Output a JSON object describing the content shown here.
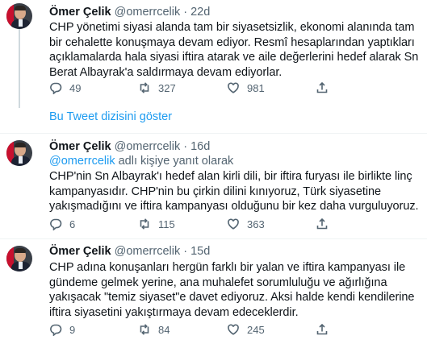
{
  "tweets": [
    {
      "name": "Ömer Çelik",
      "handle": "@omerrcelik",
      "dot": "·",
      "time": "22d",
      "reply_prefix": "",
      "reply_mention": "",
      "reply_suffix": "",
      "text": "CHP yönetimi siyasi alanda tam bir siyasetsizlik, ekonomi alanında tam bir cehalette konuşmaya devam ediyor. Resmî hesaplarından yaptıkları açıklamalarda hala siyasi iftira atarak ve aile değerlerini hedef alarak Sn Berat Albayrak'a saldırmaya devam ediyorlar.",
      "replies": "49",
      "retweets": "327",
      "likes": "981"
    },
    {
      "name": "Ömer Çelik",
      "handle": "@omerrcelik",
      "dot": "·",
      "time": "16d",
      "reply_prefix": "",
      "reply_mention": "@omerrcelik",
      "reply_suffix": " adlı kişiye yanıt olarak",
      "text": "CHP'nin Sn Albayrak'ı hedef alan kirli dili, bir iftira furyası ile birlikte linç kampanyasıdır. CHP'nin bu çirkin dilini kınıyoruz, Türk siyasetine yakışmadığını ve iftira kampanyası olduğunu bir kez daha vurguluyoruz.",
      "replies": "6",
      "retweets": "115",
      "likes": "363"
    },
    {
      "name": "Ömer Çelik",
      "handle": "@omerrcelik",
      "dot": "·",
      "time": "15d",
      "reply_prefix": "",
      "reply_mention": "",
      "reply_suffix": "",
      "text": "CHP adına konuşanları hergün farklı bir yalan ve iftira kampanyası ile gündeme gelmek yerine, ana muhalefet sorumluluğu ve ağırlığına yakışacak \"temiz siyaset\"e davet ediyoruz. Aksi halde kendi kendilerine iftira siyasetini yakıştırmaya devam edeceklerdir.",
      "replies": "9",
      "retweets": "84",
      "likes": "245"
    }
  ],
  "show_thread_label": "Bu Tweet dizisini göster",
  "icons": {
    "reply": "reply-icon",
    "retweet": "retweet-icon",
    "like": "heart-icon",
    "share": "share-icon",
    "avatar": "avatar"
  },
  "colors": {
    "link": "#1d9bf0",
    "muted": "#536471",
    "text": "#0f1419",
    "divider": "#eff3f4"
  }
}
